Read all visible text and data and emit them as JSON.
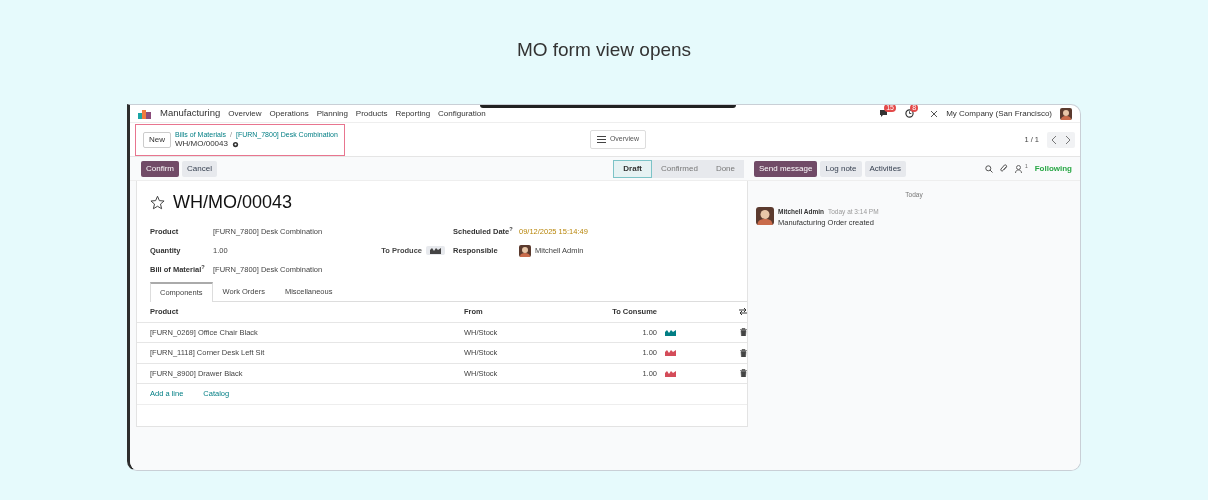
{
  "page_title": "MO form view opens",
  "navbar": {
    "app": "Manufacturing",
    "menus": [
      "Overview",
      "Operations",
      "Planning",
      "Products",
      "Reporting",
      "Configuration"
    ],
    "messages_count": "15",
    "activities_count": "8",
    "company": "My Company (San Francisco)"
  },
  "control_panel": {
    "new_button": "New",
    "breadcrumbs": [
      "Bills of Materials",
      "[FURN_7800] Desk Combination"
    ],
    "separator": "/",
    "record": "WH/MO/00043",
    "highlighted": true,
    "view_button": "Overview",
    "pager": "1 / 1"
  },
  "actions": [
    {
      "label": "Confirm",
      "kind": "primary"
    },
    {
      "label": "Cancel",
      "kind": "secondary"
    }
  ],
  "status_steps": [
    {
      "label": "Draft",
      "selected": true
    },
    {
      "label": "Confirmed",
      "selected": false
    },
    {
      "label": "Done",
      "selected": false
    }
  ],
  "chatter": {
    "buttons": [
      {
        "label": "Send message",
        "kind": "primary"
      },
      {
        "label": "Log note",
        "kind": "secondary"
      },
      {
        "label": "Activities",
        "kind": "secondary"
      }
    ],
    "followers_count": "1",
    "follow_label": "Following",
    "date_separator": "Today",
    "messages": [
      {
        "author": "Mitchell Admin",
        "time": "Today at 3:14 PM",
        "body": "Manufacturing Order created"
      }
    ]
  },
  "form": {
    "starred": false,
    "title": "WH/MO/00043",
    "left_fields": [
      {
        "label": "Product",
        "value": "[FURN_7800] Desk Combination"
      },
      {
        "label": "Quantity",
        "value": "1.00"
      },
      {
        "label": "Bill of Material$^{?}$",
        "value": "[FURN_7800] Desk Combination"
      }
    ],
    "to_produce_label": "To Produce",
    "right_fields": [
      {
        "label": "Scheduled Date$^{?}$",
        "value": "09/12/2025 15:14:49",
        "kind": "date"
      },
      {
        "label": "Responsible",
        "value": "Mitchell Admin",
        "kind": "user"
      }
    ],
    "tabs": [
      {
        "label": "Components",
        "selected": true
      },
      {
        "label": "Work Orders",
        "selected": false
      },
      {
        "label": "Miscellaneous",
        "selected": false
      }
    ],
    "table": {
      "columns": [
        "Product",
        "From",
        "To Consume"
      ],
      "rows": [
        {
          "product": "[FURN_0269] Office Chair Black",
          "from": "WH/Stock",
          "to_consume": "1.00",
          "color": "#017e84"
        },
        {
          "product": "[FURN_1118] Corner Desk Left Sit",
          "from": "WH/Stock",
          "to_consume": "1.00",
          "color": "#d44c59"
        },
        {
          "product": "[FURN_8900] Drawer Black",
          "from": "WH/Stock",
          "to_consume": "1.00",
          "color": "#d44c59"
        }
      ],
      "links": [
        "Add a line",
        "Catalog"
      ]
    }
  }
}
